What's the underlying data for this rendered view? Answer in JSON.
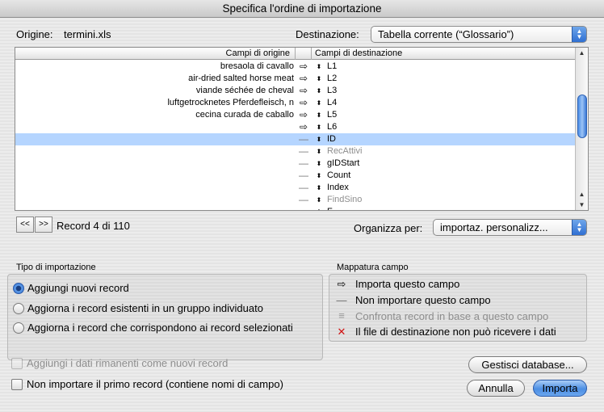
{
  "window": {
    "title": "Specifica l'ordine di importazione"
  },
  "source": {
    "label": "Origine:",
    "file": "termini.xls"
  },
  "destination": {
    "label": "Destinazione:",
    "value": "Tabella corrente (“Glossario”)"
  },
  "table": {
    "col_source": "Campi di origine",
    "col_dest": "Campi di destinazione",
    "rows": [
      {
        "source": "bresaola di cavallo",
        "map": "⇨",
        "dest": "L1",
        "state": "normal"
      },
      {
        "source": "air-dried salted horse meat",
        "map": "⇨",
        "dest": "L2",
        "state": "normal"
      },
      {
        "source": "viande séchée de cheval",
        "map": "⇨",
        "dest": "L3",
        "state": "normal"
      },
      {
        "source": "luftgetrocknetes Pferdefleisch, n",
        "map": "⇨",
        "dest": "L4",
        "state": "normal"
      },
      {
        "source": "cecina curada de caballo",
        "map": "⇨",
        "dest": "L5",
        "state": "normal"
      },
      {
        "source": "",
        "map": "⇨",
        "dest": "L6",
        "state": "normal"
      },
      {
        "source": "",
        "map": "—",
        "dest": "ID",
        "state": "selected"
      },
      {
        "source": "",
        "map": "—",
        "dest": "RecAttivi",
        "state": "gray"
      },
      {
        "source": "",
        "map": "—",
        "dest": "gIDStart",
        "state": "normal"
      },
      {
        "source": "",
        "map": "—",
        "dest": "Count",
        "state": "normal"
      },
      {
        "source": "",
        "map": "—",
        "dest": "Index",
        "state": "normal"
      },
      {
        "source": "",
        "map": "—",
        "dest": "FindSino",
        "state": "gray"
      },
      {
        "source": "",
        "map": "—",
        "dest": "F",
        "state": "normal"
      }
    ]
  },
  "nav": {
    "prev": "<<",
    "next": ">>",
    "record_text": "Record 4 di 110"
  },
  "organize": {
    "label": "Organizza per:",
    "value": "importaz. personalizz..."
  },
  "import_type": {
    "title": "Tipo di importazione",
    "options": [
      {
        "label": "Aggiungi nuovi record",
        "selected": true
      },
      {
        "label": "Aggiorna i record esistenti in un gruppo individuato",
        "selected": false
      },
      {
        "label": "Aggiorna i record che corrispondono ai record selezionati",
        "selected": false
      }
    ]
  },
  "mapping_legend": {
    "title": "Mappatura campo",
    "items": [
      {
        "icon": "arrow-right-icon",
        "label": "Importa questo campo",
        "disabled": false
      },
      {
        "icon": "dash-icon",
        "label": "Non importare questo campo",
        "disabled": false
      },
      {
        "icon": "equals-icon",
        "label": "Confronta record in base a questo campo",
        "disabled": true
      },
      {
        "icon": "red-x-icon",
        "label": "Il file di destinazione non può ricevere i dati",
        "disabled": false
      }
    ]
  },
  "checkboxes": {
    "add_remaining": "Aggiungi i dati rimanenti come nuovi record",
    "skip_first": "Non importare il primo record (contiene nomi di campo)"
  },
  "buttons": {
    "manage_db": "Gestisci database...",
    "cancel": "Annulla",
    "import": "Importa"
  },
  "colors": {
    "accent": "#3b76d0",
    "selection": "#b5d5ff",
    "error": "#d01010"
  }
}
